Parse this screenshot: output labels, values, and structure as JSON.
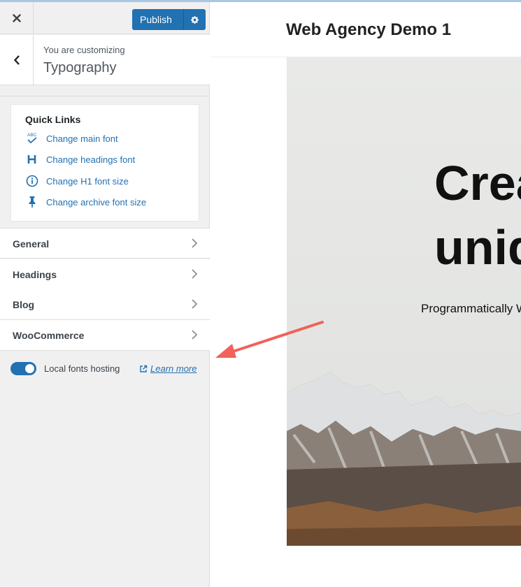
{
  "header": {
    "publish_label": "Publish"
  },
  "crumb": {
    "subtitle": "You are customizing",
    "title": "Typography"
  },
  "quick_links": {
    "title": "Quick Links",
    "items": [
      {
        "label": "Change main font",
        "icon": "spellcheck-icon"
      },
      {
        "label": "Change headings font",
        "icon": "heading-icon"
      },
      {
        "label": "Change H1 font size",
        "icon": "info-icon"
      },
      {
        "label": "Change archive font size",
        "icon": "pin-icon"
      }
    ]
  },
  "sections": [
    {
      "label": "General"
    },
    {
      "label": "Headings"
    },
    {
      "label": "Blog"
    },
    {
      "label": "WooCommerce"
    }
  ],
  "local_fonts": {
    "label": "Local fonts hosting",
    "enabled": true,
    "learn_more": "Learn more"
  },
  "preview": {
    "site_title": "Web Agency Demo 1",
    "hero_line1": "Crea",
    "hero_line2": "uniq",
    "hero_sub": "Programmatically W"
  },
  "colors": {
    "accent": "#2271b1",
    "annotation_arrow": "#f0625a"
  }
}
